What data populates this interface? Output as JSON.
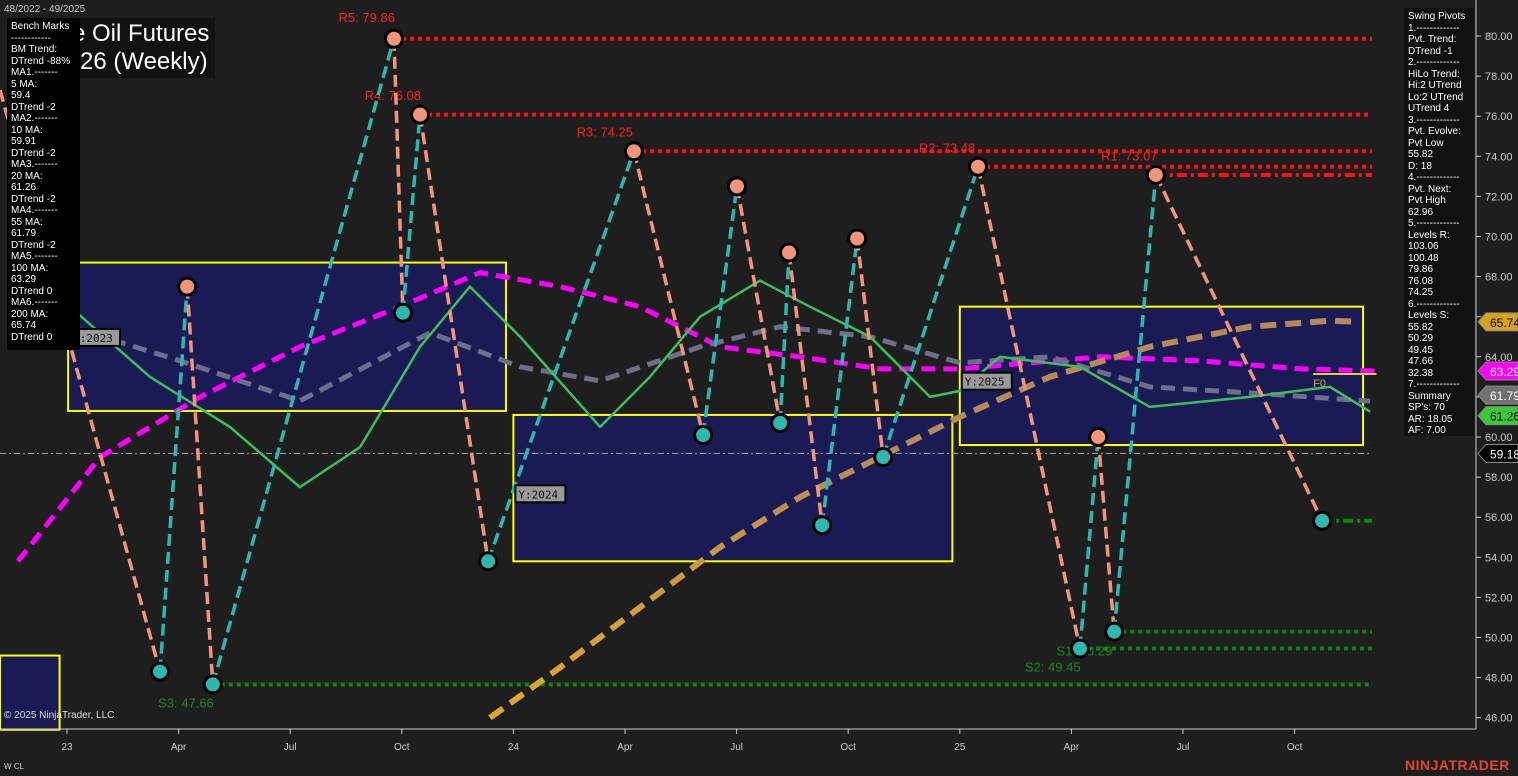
{
  "header": {
    "date_range": "48/2022 - 49/2025",
    "title_line1": "e Oil Futures",
    "title_line2": "-26 (Weekly)",
    "copyright": "© 2025 NinjaTrader, LLC",
    "symbol": "W CL",
    "brand": "NINJATRADER"
  },
  "bench_panel": {
    "lines": [
      "Bench Marks",
      "------------",
      "BM Trend:",
      "DTrend -88%",
      "MA1.-------",
      "5 MA:",
      "59.4",
      "DTrend -2",
      "MA2.-------",
      "10 MA:",
      "59.91",
      "DTrend -2",
      "MA3.-------",
      "20 MA:",
      "61.26",
      "DTrend -2",
      "MA4.-------",
      "55 MA:",
      "61.79",
      "DTrend -2",
      "MA5.-------",
      "100 MA:",
      "63.29",
      "DTrend 0",
      "MA6.-------",
      "200 MA:",
      "65.74",
      "DTrend 0"
    ]
  },
  "swing_panel": {
    "lines": [
      "Swing Pivots",
      "1.-------------",
      "Pvt. Trend:",
      "DTrend -1",
      "2.-------------",
      "HiLo Trend:",
      "Hi:2 UTrend",
      "Lo:2 UTrend",
      "UTrend 4",
      "3.-------------",
      "Pvt. Evolve:",
      "Pvt Low",
      "55.82",
      "D: 18",
      "4.-------------",
      "Pvt. Next:",
      "Pvt High",
      "62.96",
      "5.-------------",
      "Levels R:",
      "103.06",
      "100.48",
      "79.86",
      "76.08",
      "74.25",
      "6.-------------",
      "Levels S:",
      "55.82",
      "50.29",
      "49.45",
      "47.66",
      "32.38",
      "7.-------------",
      "Summary",
      "SP's: 70",
      "AR: 18.05",
      "AF: 7.00"
    ]
  },
  "chart_data": {
    "type": "line",
    "title": "Crude Oil Futures (Weekly)",
    "x_unit": "months since Jan 2023",
    "ylim": [
      46,
      81
    ],
    "xlim": [
      -1.8,
      37.8
    ],
    "y_ticks": [
      46,
      48,
      50,
      52,
      54,
      56,
      58,
      60,
      62,
      64,
      66,
      68,
      70,
      72,
      74,
      76,
      78,
      80
    ],
    "x_ticks": [
      {
        "t": 0,
        "label": "23"
      },
      {
        "t": 3,
        "label": "Apr"
      },
      {
        "t": 6,
        "label": "Jul"
      },
      {
        "t": 9,
        "label": "Oct"
      },
      {
        "t": 12,
        "label": "24"
      },
      {
        "t": 15,
        "label": "Apr"
      },
      {
        "t": 18,
        "label": "Jul"
      },
      {
        "t": 21,
        "label": "Oct"
      },
      {
        "t": 24,
        "label": "25"
      },
      {
        "t": 27,
        "label": "Apr"
      },
      {
        "t": 30,
        "label": "Jul"
      },
      {
        "t": 33,
        "label": "Oct"
      }
    ],
    "last_price": 59.18,
    "price_tags": [
      {
        "label": "65.74",
        "value": 65.74,
        "color": "#d9a21b",
        "text": "#000"
      },
      {
        "label": "63.29",
        "value": 63.29,
        "color": "#ff00ff",
        "text": "#fff"
      },
      {
        "label": "61.79",
        "value": 61.79,
        "color": "#707070",
        "text": "#fff"
      },
      {
        "label": "61.26",
        "value": 61.26,
        "color": "#33cc33",
        "text": "#000"
      },
      {
        "label": "59.18",
        "value": 59.18,
        "color": "#000000",
        "text": "#fff"
      }
    ],
    "pivots": [
      {
        "t": -1.8,
        "v": 77.3,
        "type": "H"
      },
      {
        "t": 2.5,
        "v": 48.3,
        "type": "L"
      },
      {
        "t": 3.23,
        "v": 67.5,
        "type": "H"
      },
      {
        "t": 3.92,
        "v": 47.66,
        "type": "L"
      },
      {
        "t": 8.79,
        "v": 79.86,
        "type": "H"
      },
      {
        "t": 9.03,
        "v": 66.2,
        "type": "L"
      },
      {
        "t": 9.49,
        "v": 76.08,
        "type": "H"
      },
      {
        "t": 11.32,
        "v": 53.8,
        "type": "L"
      },
      {
        "t": 15.24,
        "v": 74.25,
        "type": "H"
      },
      {
        "t": 17.1,
        "v": 60.1,
        "type": "L"
      },
      {
        "t": 18.01,
        "v": 72.5,
        "type": "H"
      },
      {
        "t": 19.17,
        "v": 60.7,
        "type": "L"
      },
      {
        "t": 19.41,
        "v": 69.2,
        "type": "H"
      },
      {
        "t": 20.3,
        "v": 55.6,
        "type": "L"
      },
      {
        "t": 21.24,
        "v": 69.9,
        "type": "H"
      },
      {
        "t": 21.94,
        "v": 59.0,
        "type": "L"
      },
      {
        "t": 24.49,
        "v": 73.48,
        "type": "H"
      },
      {
        "t": 27.23,
        "v": 49.45,
        "type": "L"
      },
      {
        "t": 27.72,
        "v": 60.0,
        "type": "H"
      },
      {
        "t": 28.15,
        "v": 50.29,
        "type": "L"
      },
      {
        "t": 29.27,
        "v": 73.07,
        "type": "H"
      },
      {
        "t": 33.74,
        "v": 55.82,
        "type": "L"
      }
    ],
    "levels": [
      {
        "label": "R5: 79.86",
        "value": 79.86,
        "from": 8.79,
        "kind": "R",
        "lt": 7.3,
        "lv": 80.7
      },
      {
        "label": "R4: 76.08",
        "value": 76.08,
        "from": 9.49,
        "kind": "R",
        "lt": 8.0,
        "lv": 76.8
      },
      {
        "label": "R3: 74.25",
        "value": 74.25,
        "from": 15.24,
        "kind": "R",
        "lt": 13.7,
        "lv": 75.0
      },
      {
        "label": "R2: 73.48",
        "value": 73.48,
        "from": 24.49,
        "kind": "R",
        "lt": 22.9,
        "lv": 74.2
      },
      {
        "label": "R1: 73.07",
        "value": 73.07,
        "from": 29.27,
        "kind": "R1",
        "lt": 27.8,
        "lv": 73.8
      },
      {
        "label": "S3: 47.66",
        "value": 47.66,
        "from": 3.92,
        "kind": "S",
        "lt": 2.45,
        "lv": 46.5
      },
      {
        "label": "S2: 49.45",
        "value": 49.45,
        "from": 27.23,
        "kind": "S",
        "lt": 25.75,
        "lv": 48.3
      },
      {
        "label": "S1: 50.29",
        "value": 50.29,
        "from": 28.15,
        "kind": "S",
        "lt": 26.6,
        "lv": 49.1
      },
      {
        "label": "",
        "value": 55.82,
        "from": 33.74,
        "kind": "S0",
        "lt": 0,
        "lv": 0
      }
    ],
    "year_boxes": [
      {
        "label": "",
        "from": -1.8,
        "to": -0.2,
        "hi": 49.1,
        "lo": 45.4
      },
      {
        "label": "Y:2023",
        "from": 0.03,
        "to": 11.8,
        "hi": 68.7,
        "lo": 61.3
      },
      {
        "label": "Y:2024",
        "from": 12.0,
        "to": 23.8,
        "hi": 61.1,
        "lo": 53.8
      },
      {
        "label": "Y:2025",
        "from": 24.0,
        "to": 34.84,
        "hi": 66.5,
        "lo": 59.6
      }
    ],
    "f0": {
      "label": "F0",
      "value": 63.29,
      "from": 33.5,
      "to": 35.2
    },
    "series": [
      {
        "name": "100 MA",
        "color": "#ff00ff",
        "width": 5,
        "dash": "14 8",
        "points": [
          [
            -1.32,
            53.8
          ],
          [
            0.89,
            59
          ],
          [
            3.58,
            62
          ],
          [
            6.26,
            64.5
          ],
          [
            8.95,
            66.5
          ],
          [
            11.1,
            68.2
          ],
          [
            13.25,
            67.5
          ],
          [
            15.4,
            66.5
          ],
          [
            17.55,
            64.5
          ],
          [
            19.7,
            64
          ],
          [
            21.85,
            63.4
          ],
          [
            24.0,
            63.4
          ],
          [
            27.77,
            64
          ],
          [
            30.46,
            63.8
          ],
          [
            33.15,
            63.4
          ],
          [
            35.16,
            63.29
          ]
        ]
      },
      {
        "name": "200 MA",
        "color": "#b8885a",
        "color2": "#e0a82a",
        "width": 6,
        "dash": "16 9",
        "points": [
          [
            11.37,
            46
          ],
          [
            13.25,
            48.5
          ],
          [
            15.4,
            51.5
          ],
          [
            17.55,
            54.5
          ],
          [
            19.7,
            57
          ],
          [
            21.85,
            59
          ],
          [
            24.0,
            61
          ],
          [
            26.42,
            63
          ],
          [
            29.11,
            64.5
          ],
          [
            31.8,
            65.5
          ],
          [
            33.95,
            65.8
          ],
          [
            34.76,
            65.74
          ]
        ]
      },
      {
        "name": "55 MA",
        "color": "#6e6e8a",
        "width": 5,
        "dash": "14 8",
        "points": [
          [
            0.08,
            65.5
          ],
          [
            3.04,
            63.8
          ],
          [
            6.26,
            61.8
          ],
          [
            9.76,
            65.2
          ],
          [
            12.18,
            63.5
          ],
          [
            14.33,
            62.8
          ],
          [
            17.02,
            64.5
          ],
          [
            19.17,
            65.5
          ],
          [
            21.59,
            65
          ],
          [
            24.0,
            63.7
          ],
          [
            26.42,
            64
          ],
          [
            29.11,
            62.5
          ],
          [
            31.8,
            62.2
          ],
          [
            35.03,
            61.79
          ]
        ]
      },
      {
        "name": "20 MA",
        "color": "#3cbf5a",
        "width": 2.5,
        "dash": "",
        "points": [
          [
            0.08,
            66.5
          ],
          [
            2.23,
            63
          ],
          [
            4.38,
            60.5
          ],
          [
            6.26,
            57.5
          ],
          [
            7.88,
            59.5
          ],
          [
            9.49,
            64.5
          ],
          [
            10.83,
            67.5
          ],
          [
            12.18,
            65
          ],
          [
            14.33,
            60.5
          ],
          [
            15.67,
            63
          ],
          [
            17.02,
            66
          ],
          [
            18.63,
            67.8
          ],
          [
            19.97,
            66.5
          ],
          [
            21.59,
            65
          ],
          [
            23.2,
            62
          ],
          [
            24.0,
            62.3
          ],
          [
            25.08,
            64
          ],
          [
            27.23,
            63.5
          ],
          [
            29.11,
            61.5
          ],
          [
            31.8,
            62
          ],
          [
            33.95,
            62.5
          ],
          [
            35.03,
            61.26
          ]
        ]
      }
    ]
  }
}
